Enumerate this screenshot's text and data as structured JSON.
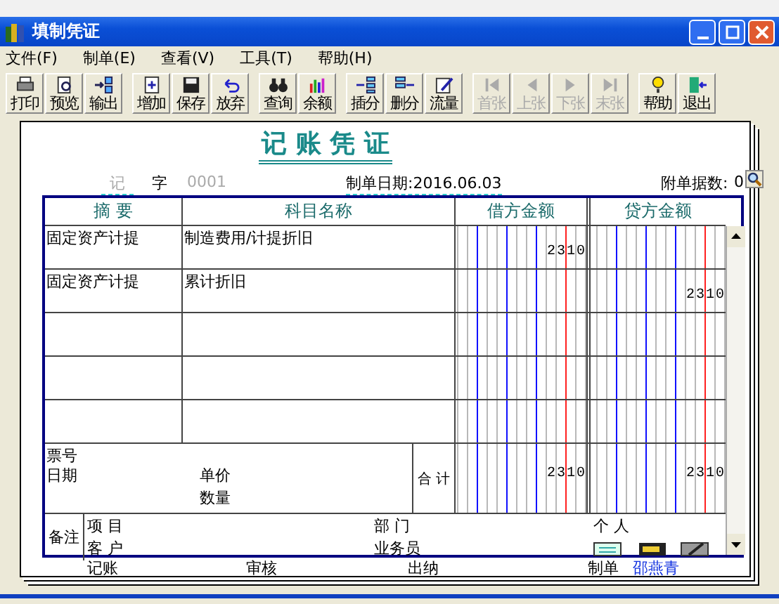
{
  "window": {
    "title": "填制凭证"
  },
  "menu": [
    "文件(F)",
    "制单(E)",
    "查看(V)",
    "工具(T)",
    "帮助(H)"
  ],
  "toolbar": [
    {
      "buttons": [
        {
          "label": "打印",
          "disabled": false
        },
        {
          "label": "预览",
          "disabled": false
        },
        {
          "label": "输出",
          "disabled": false
        }
      ]
    },
    {
      "buttons": [
        {
          "label": "增加",
          "disabled": false
        },
        {
          "label": "保存",
          "disabled": false
        },
        {
          "label": "放弃",
          "disabled": false
        }
      ]
    },
    {
      "buttons": [
        {
          "label": "查询",
          "disabled": false
        },
        {
          "label": "余额",
          "disabled": false
        }
      ]
    },
    {
      "buttons": [
        {
          "label": "插分",
          "disabled": false
        },
        {
          "label": "删分",
          "disabled": false
        },
        {
          "label": "流量",
          "disabled": false
        }
      ]
    },
    {
      "buttons": [
        {
          "label": "首张",
          "disabled": true
        },
        {
          "label": "上张",
          "disabled": true
        },
        {
          "label": "下张",
          "disabled": true
        },
        {
          "label": "末张",
          "disabled": true
        }
      ]
    },
    {
      "buttons": [
        {
          "label": "帮助",
          "disabled": false
        },
        {
          "label": "退出",
          "disabled": false
        }
      ]
    }
  ],
  "voucher": {
    "title": "记 账 凭 证",
    "type": "记",
    "type_suffix": "字",
    "number": "0001",
    "date_label": "制单日期:",
    "date": "2016.06.03",
    "attachments_label": "附单据数:",
    "attachments": "0",
    "columns": [
      "摘 要",
      "科目名称",
      "借方金额",
      "贷方金额"
    ],
    "rows": [
      {
        "summary": "固定资产计提",
        "account": "制造费用/计提折旧",
        "debit": "2310"
      },
      {
        "summary": "固定资产计提",
        "account": "累计折旧",
        "credit": "2310"
      }
    ],
    "totals": {
      "ticket_label": "票号",
      "date_label": "日期",
      "unit_price_label": "单价",
      "quantity_label": "数量",
      "total_label": "合 计",
      "debit": "2310",
      "credit": "2310"
    },
    "remarks": {
      "label": "备注",
      "project": "项 目",
      "department": "部 门",
      "person": "个 人",
      "customer": "客 户",
      "salesman": "业务员"
    },
    "signatures": [
      {
        "label": "记账"
      },
      {
        "label": "审核"
      },
      {
        "label": "出纳"
      },
      {
        "label": "制单",
        "name": "邵燕青"
      }
    ]
  }
}
